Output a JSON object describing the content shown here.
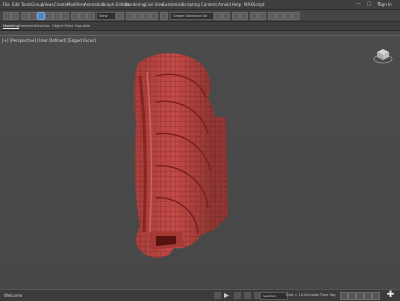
{
  "menubar": {
    "items": [
      "File",
      "Edit",
      "Tools",
      "Group",
      "Views",
      "Create",
      "Modifiers",
      "Animation",
      "Graph Editors",
      "Rendering",
      "Civil View",
      "Customize",
      "Scripting",
      "Content",
      "Arnold",
      "Help",
      "MAXScript"
    ],
    "signin": "Sign In"
  },
  "toolbar": {
    "view_dropdown": "View",
    "selection_set": "Create Selection Se"
  },
  "ribbon": {
    "tabs": [
      "Modeling",
      "Freeform",
      "Selection",
      "Object Paint",
      "Populate"
    ],
    "active_tab": "Modeling"
  },
  "viewport": {
    "label": "[+] [Perspective] [User Defined] [Edged Faces]"
  },
  "statusbar": {
    "text": "Welcome",
    "grid": "Grid = 10.0cm",
    "add_time_tag": "Add Time Tag",
    "selected": "Selected"
  },
  "colors": {
    "accent": "#4f86c6",
    "model": "#c24a46"
  }
}
